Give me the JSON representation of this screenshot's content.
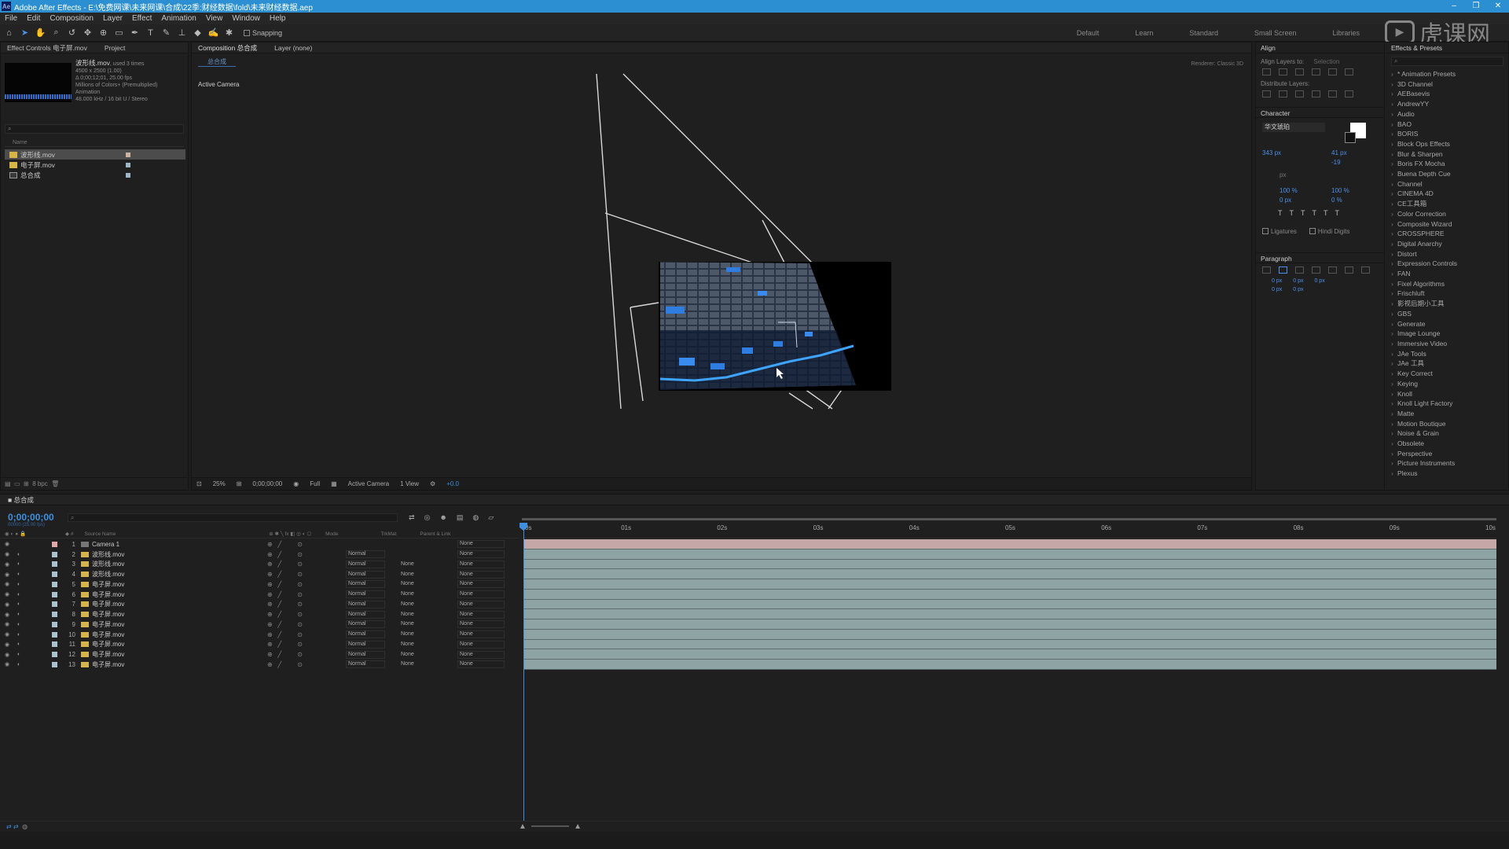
{
  "title": "Adobe After Effects - E:\\免费网课\\未来网课\\合成\\22季:财经数据\\fold\\未来财经数据.aep",
  "window_controls": [
    "–",
    "❐",
    "✕"
  ],
  "menu": [
    "File",
    "Edit",
    "Composition",
    "Layer",
    "Effect",
    "Animation",
    "View",
    "Window",
    "Help"
  ],
  "toolbar": {
    "snapping_label": "Snapping"
  },
  "workspaces": [
    "Default",
    "Learn",
    "Standard",
    "Small Screen",
    "Libraries"
  ],
  "watermark": "虎课网",
  "left_panel": {
    "tabs": [
      "Effect Controls 电子屏.mov",
      "Project"
    ],
    "selected_file": "波形线.mov",
    "used_text": ", used 3 times",
    "info_lines": [
      "4500 x 2500 (1.00)",
      "Δ 0;00;12;01, 25.00 fps",
      "Millions of Colors+ (Premultiplied)",
      "Animation",
      "48.000 kHz / 16 bit U / Stereo"
    ],
    "search_placeholder": "⌕",
    "col_name": "Name",
    "files": [
      {
        "name": "波形线.mov",
        "type": "footage",
        "selected": true
      },
      {
        "name": "电子屏.mov",
        "type": "footage",
        "selected": false
      },
      {
        "name": "总合成",
        "type": "comp",
        "selected": false
      }
    ],
    "footer_bpc": "8 bpc"
  },
  "comp_panel": {
    "tabs": [
      "Composition 总合成",
      "Layer (none)"
    ],
    "subtab": "总合成",
    "renderer_label": "Renderer:",
    "renderer_value": "Classic 3D",
    "active_camera": "Active Camera",
    "footer": {
      "zoom": "25%",
      "timecode": "0;00;00;00",
      "resolution": "Full",
      "view": "Active Camera",
      "views": "1 View",
      "exposure": "+0.0"
    }
  },
  "right_panel": {
    "align_title": "Align",
    "align_layers_to": "Align Layers to:",
    "align_target": "Selection",
    "distribute_label": "Distribute Layers:",
    "character_title": "Character",
    "font_name": "华文琥珀",
    "font_size": "343 px",
    "leading": "41 px",
    "tracking": "-19",
    "unit": "px",
    "vscale": "100 %",
    "hscale": "100 %",
    "baseline": "0 px",
    "tsume": "0 %",
    "ligatures": "Ligatures",
    "hindi_digits": "Hindi Digits",
    "paragraph_title": "Paragraph",
    "para_values": [
      "0 px",
      "0 px",
      "0 px",
      "0 px",
      "0 px"
    ],
    "effects_title": "Effects & Presets",
    "effects_search": "⌕",
    "effects": [
      "* Animation Presets",
      "3D Channel",
      "AEBasevis",
      "AndrewYY",
      "Audio",
      "BAO",
      "BORIS",
      "Block Ops Effects",
      "Blur & Sharpen",
      "Boris FX Mocha",
      "Buena Depth Cue",
      "Channel",
      "CINEMA 4D",
      "CE工具箱",
      "Color Correction",
      "Composite Wizard",
      "CROSSPHERE",
      "Digital Anarchy",
      "Distort",
      "Expression Controls",
      "FAN",
      "Fixel Algorithms",
      "Frischluft",
      "影视后期小工具",
      "GBS",
      "Generate",
      "Image Lounge",
      "Immersive Video",
      "JAe Tools",
      "JAe 工具",
      "Key Correct",
      "Keying",
      "Knoll",
      "Knoll Light Factory",
      "Matte",
      "Motion Boutique",
      "Noise & Grain",
      "Obsolete",
      "Perspective",
      "Picture Instruments",
      "Plexus"
    ]
  },
  "timeline": {
    "tab": "总合成",
    "timecode": "0;00;00;00",
    "fps": "00000 (25.00 fps)",
    "search_placeholder": "⌕",
    "columns": {
      "source": "Source Name",
      "mode": "Mode",
      "trkmat": "TrkMat",
      "parent": "Parent & Link"
    },
    "ruler": [
      "0s",
      "01s",
      "02s",
      "03s",
      "04s",
      "05s",
      "06s",
      "07s",
      "08s",
      "09s",
      "10s"
    ],
    "layers": [
      {
        "num": "1",
        "name": "Camera 1",
        "mode": "",
        "trk": "",
        "parent": "None",
        "kind": "camera"
      },
      {
        "num": "2",
        "name": "波形线.mov",
        "mode": "Normal",
        "trk": "",
        "parent": "None",
        "kind": "footage"
      },
      {
        "num": "3",
        "name": "波形线.mov",
        "mode": "Normal",
        "trk": "None",
        "parent": "None",
        "kind": "footage"
      },
      {
        "num": "4",
        "name": "波形线.mov",
        "mode": "Normal",
        "trk": "None",
        "parent": "None",
        "kind": "footage"
      },
      {
        "num": "5",
        "name": "电子屏.mov",
        "mode": "Normal",
        "trk": "None",
        "parent": "None",
        "kind": "footage"
      },
      {
        "num": "6",
        "name": "电子屏.mov",
        "mode": "Normal",
        "trk": "None",
        "parent": "None",
        "kind": "footage"
      },
      {
        "num": "7",
        "name": "电子屏.mov",
        "mode": "Normal",
        "trk": "None",
        "parent": "None",
        "kind": "footage"
      },
      {
        "num": "8",
        "name": "电子屏.mov",
        "mode": "Normal",
        "trk": "None",
        "parent": "None",
        "kind": "footage"
      },
      {
        "num": "9",
        "name": "电子屏.mov",
        "mode": "Normal",
        "trk": "None",
        "parent": "None",
        "kind": "footage"
      },
      {
        "num": "10",
        "name": "电子屏.mov",
        "mode": "Normal",
        "trk": "None",
        "parent": "None",
        "kind": "footage"
      },
      {
        "num": "11",
        "name": "电子屏.mov",
        "mode": "Normal",
        "trk": "None",
        "parent": "None",
        "kind": "footage"
      },
      {
        "num": "12",
        "name": "电子屏.mov",
        "mode": "Normal",
        "trk": "None",
        "parent": "None",
        "kind": "footage"
      },
      {
        "num": "13",
        "name": "电子屏.mov",
        "mode": "Normal",
        "trk": "None",
        "parent": "None",
        "kind": "footage"
      }
    ]
  },
  "colors": {
    "accent": "#3e8fe0",
    "titlebar": "#2b8fd1",
    "footage_bar": "#8ea3a3",
    "camera_bar": "#c6a7a8"
  }
}
